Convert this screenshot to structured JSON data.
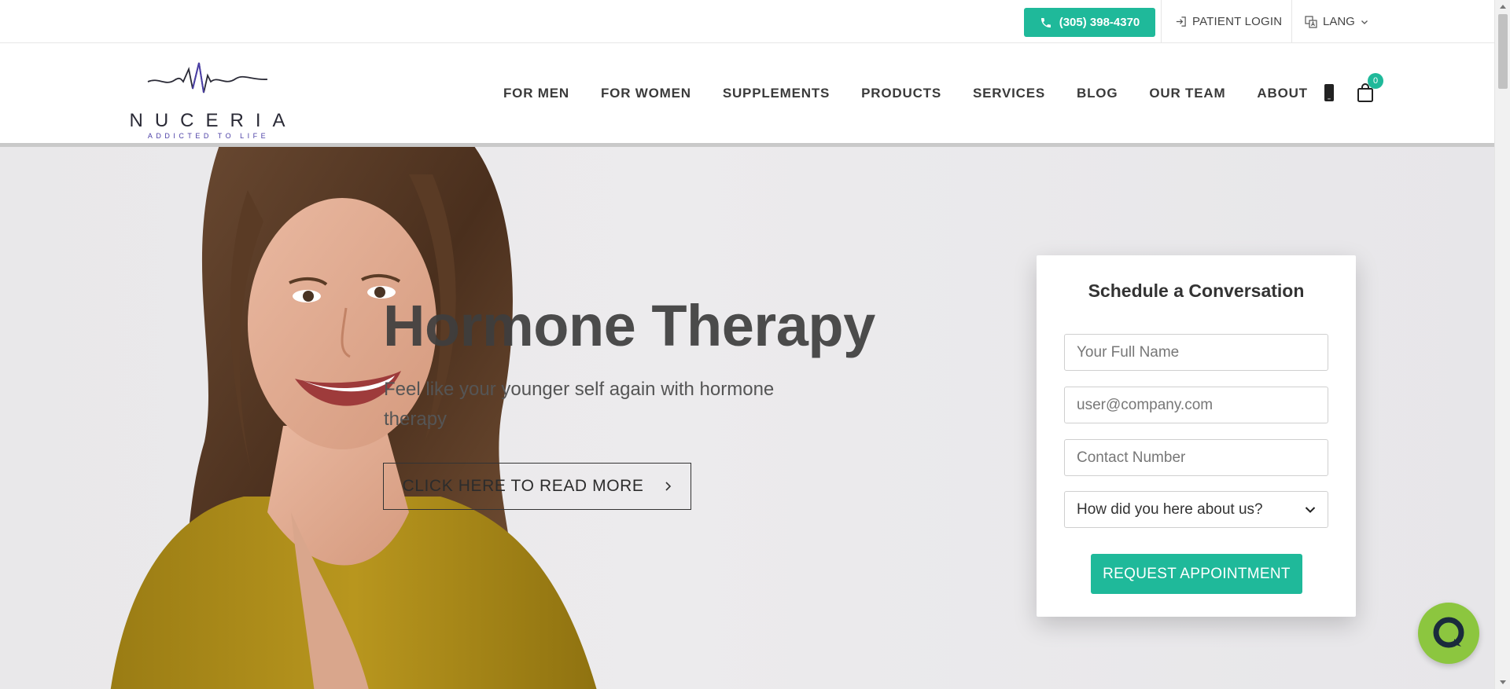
{
  "topbar": {
    "phone_label": "(305) 398-4370",
    "patient_login_label": "PATIENT LOGIN",
    "lang_label": "LANG",
    "icons": [
      "phone-icon",
      "login-icon",
      "translate-icon",
      "chevron-down-icon"
    ]
  },
  "brand": {
    "name": "NUCERIA",
    "tagline": "ADDICTED TO LIFE",
    "logo_accent": "#4b3fa6"
  },
  "nav": {
    "items": [
      {
        "label": "FOR MEN"
      },
      {
        "label": "FOR WOMEN"
      },
      {
        "label": "SUPPLEMENTS"
      },
      {
        "label": "PRODUCTS"
      },
      {
        "label": "SERVICES"
      },
      {
        "label": "BLOG"
      },
      {
        "label": "OUR TEAM"
      },
      {
        "label": "ABOUT"
      }
    ],
    "cart_count": "0"
  },
  "hero": {
    "title": "Hormone Therapy",
    "subtitle": "Feel like your younger self again with hormone therapy",
    "cta_label": "CLICK HERE TO READ MORE",
    "cta_icon": "chevron-right-icon"
  },
  "form": {
    "title": "Schedule a Conversation",
    "name_placeholder": "Your Full Name",
    "email_placeholder": "user@company.com",
    "phone_placeholder": "Contact Number",
    "referral_selected": "How did you here about us?",
    "submit_label": "REQUEST APPOINTMENT"
  },
  "colors": {
    "accent": "#1fb99a",
    "chat_bubble": "#8cc63f",
    "text_dark": "#3a3a3a"
  }
}
